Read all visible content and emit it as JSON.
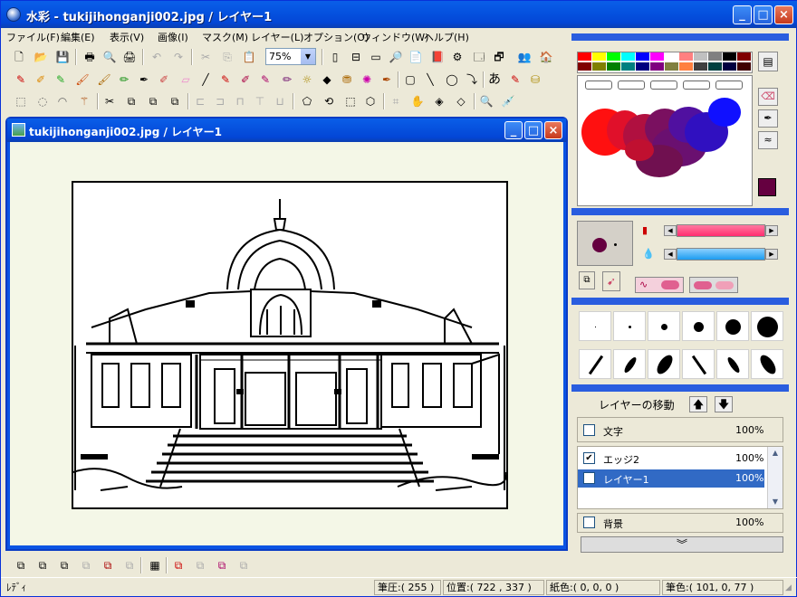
{
  "app": {
    "title": "水彩 - tukijihonganji002.jpg / レイヤー1"
  },
  "window_controls": {
    "minimize": "_",
    "maximize": "□",
    "close": "×"
  },
  "menu": [
    "ファイル(F)",
    "編集(E)",
    "表示(V)",
    "画像(I)",
    "マスク(M)",
    "レイヤー(L)",
    "オプション(O)",
    "ウィンドウ(W)",
    "ヘルプ(H)"
  ],
  "toolbar": {
    "zoom": "75%"
  },
  "document": {
    "title": "tukijihonganji002.jpg / レイヤー1"
  },
  "palette": {
    "colors_row1": [
      "#ff0000",
      "#ffff00",
      "#00ff00",
      "#00ffff",
      "#0000ff",
      "#ff00ff",
      "#ffffff",
      "#ff8080",
      "#c0c0c0",
      "#808080",
      "#000000",
      "#800000"
    ],
    "colors_row2": [
      "#800000",
      "#808000",
      "#008000",
      "#008080",
      "#000080",
      "#800080",
      "#808040",
      "#ff8040",
      "#404040",
      "#004040",
      "#000040",
      "#400000"
    ],
    "main_color": "#650040"
  },
  "layers": {
    "move_label": "レイヤーの移動",
    "items": [
      {
        "name": "文字",
        "opacity": "100%",
        "checked": false
      },
      {
        "name": "エッジ2",
        "opacity": "100%",
        "checked": true
      },
      {
        "name": "レイヤー1",
        "opacity": "100%",
        "checked": false,
        "selected": true
      },
      {
        "name": "背景",
        "opacity": "100%",
        "checked": false
      }
    ]
  },
  "status": {
    "ready": "ﾚﾃﾞｨ",
    "pressure": "筆圧:( 255 )",
    "position": "位置:( 722 , 337 )",
    "paper_color": "紙色:( 0, 0, 0 )",
    "brush_color": "筆色:( 101, 0, 77 )"
  },
  "text_tool_glyph": "あ"
}
